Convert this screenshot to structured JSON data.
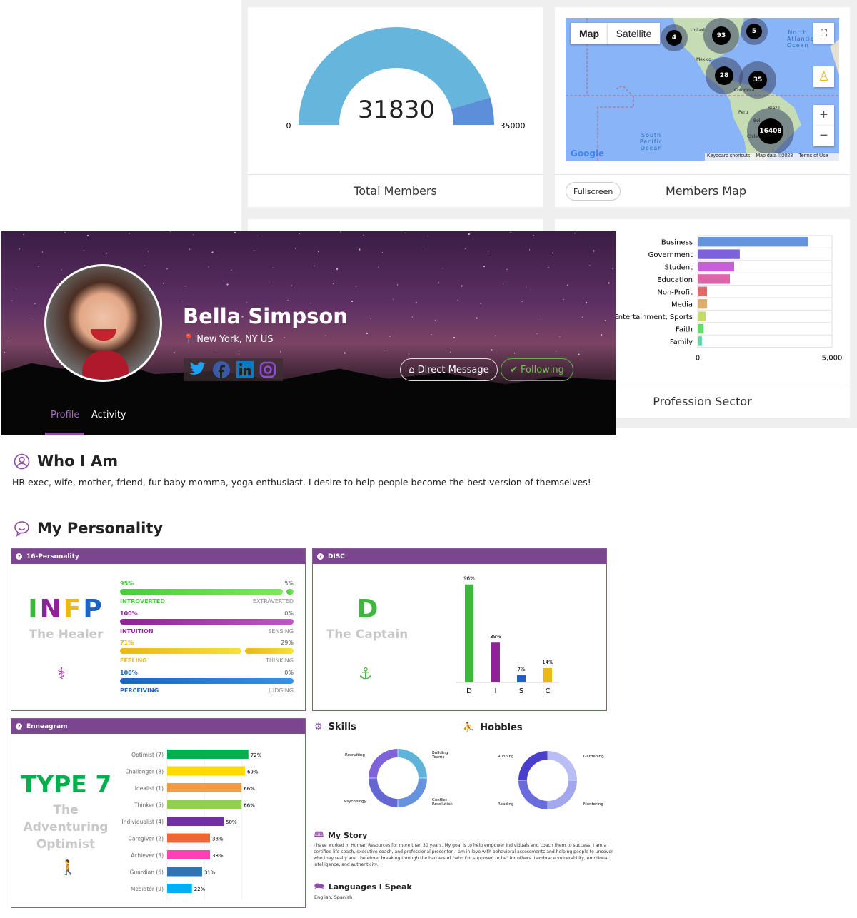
{
  "gauge": {
    "value": 31830,
    "min": 0,
    "max": 35000,
    "min_label": "0",
    "max_label": "35000",
    "title": "Total Members",
    "colors": [
      "#66b5dc",
      "#5c8fd9"
    ]
  },
  "map": {
    "tab_map": "Map",
    "tab_satellite": "Satellite",
    "clusters": [
      "4",
      "93",
      "5",
      "28",
      "35",
      "16408"
    ],
    "labels": {
      "ocean1": "North Atlantic Ocean",
      "ocean2": "South Pacific Ocean",
      "mexico": "Mexico",
      "colombia": "Colombia",
      "peru": "Peru",
      "brazil": "Brazil",
      "chile": "Chile",
      "united": "United",
      "bol": "Bol"
    },
    "attribution": {
      "shortcuts": "Keyboard shortcuts",
      "data": "Map data ©2023",
      "terms": "Terms of Use",
      "logo": "Google"
    },
    "fullscreen_button": "Fullscreen",
    "title": "Members Map"
  },
  "chart_data": [
    {
      "type": "bar",
      "orientation": "horizontal",
      "title": "Profession Sector",
      "categories": [
        "Business",
        "Government",
        "Student",
        "Education",
        "Non-Profit",
        "Media",
        "e, Entertainment, Sports",
        "Faith",
        "Family"
      ],
      "values": [
        4070,
        1540,
        1330,
        1170,
        320,
        320,
        270,
        190,
        130
      ],
      "xlim": [
        0,
        5000
      ],
      "xticks": [
        "0",
        "5,000"
      ],
      "colors": [
        "#6694dc",
        "#7b61db",
        "#c75fd9",
        "#dc64a9",
        "#e06868",
        "#e0ac66",
        "#c5dc64",
        "#66db66",
        "#5fd9a0"
      ],
      "grid": true
    },
    {
      "type": "bar",
      "title": "DISC",
      "categories": [
        "D",
        "I",
        "S",
        "C"
      ],
      "values": [
        96,
        39,
        7,
        14
      ],
      "labels": [
        "96%",
        "39%",
        "7%",
        "14%"
      ],
      "colors": [
        "#3db83a",
        "#8e2296",
        "#1d63c4",
        "#e9b916"
      ]
    },
    {
      "type": "bar",
      "orientation": "horizontal",
      "title": "Enneagram",
      "categories": [
        "Optimist (7)",
        "Challenger (8)",
        "Idealist (1)",
        "Thinker (5)",
        "Individualist (4)",
        "Caregiver (2)",
        "Achiever (3)",
        "Guardian (6)",
        "Mediator (9)"
      ],
      "values": [
        72,
        69,
        66,
        66,
        50,
        38,
        38,
        31,
        22
      ],
      "labels": [
        "72%",
        "69%",
        "66%",
        "66%",
        "50%",
        "38%",
        "38%",
        "31%",
        "22%"
      ],
      "colors": [
        "#00b04f",
        "#ffd900",
        "#f39a45",
        "#92d050",
        "#7030a0",
        "#ec6636",
        "#ff40b4",
        "#2e75b6",
        "#00b0f0"
      ]
    },
    {
      "type": "pie",
      "title": "Skills",
      "categories": [
        "Building Teams",
        "Conflict Resolution",
        "Psychology",
        "Recruiting"
      ],
      "values": [
        25,
        25,
        25,
        25
      ],
      "colors": [
        "#5fb3d9",
        "#6593dd",
        "#6466d4",
        "#7d62d9"
      ]
    },
    {
      "type": "pie",
      "title": "Hobbies",
      "categories": [
        "Gardening",
        "Mentoring",
        "Reading",
        "Running"
      ],
      "values": [
        25,
        25,
        25,
        25
      ],
      "colors": [
        "#b8bdf5",
        "#a3a8ee",
        "#6a6bdc",
        "#4a3fcc"
      ]
    }
  ],
  "profile": {
    "name": "Bella Simpson",
    "location": "New York, NY US",
    "direct_message": "Direct Message",
    "following": "Following",
    "tabs": [
      "Profile",
      "Activity"
    ],
    "socials": [
      "twitter-icon",
      "facebook-icon",
      "linkedin-icon",
      "instagram-icon"
    ]
  },
  "who": {
    "title": "Who I Am",
    "text": "HR exec, wife, mother, friend, fur baby momma, yoga enthusiast. I desire to help people become the best version of themselves!"
  },
  "personality": {
    "title": "My Personality",
    "sixteen": {
      "header": "16-Personality",
      "type": "INFP",
      "subtitle": "The Healer",
      "type_colors": [
        "#3db83a",
        "#8e2296",
        "#e9b916",
        "#1d63c4"
      ],
      "traits": [
        {
          "left_pct": "95%",
          "right_pct": "5%",
          "left": "INTROVERTED",
          "right": "EXTRAVERTED",
          "value": 95,
          "color": "#4cc83f",
          "color2": "#7ee85f"
        },
        {
          "left_pct": "100%",
          "right_pct": "0%",
          "left": "INTUITION",
          "right": "SENSING",
          "value": 100,
          "color": "#8e2296",
          "color2": "#c056c6"
        },
        {
          "left_pct": "71%",
          "right_pct": "29%",
          "left": "FEELING",
          "right": "THINKING",
          "value": 71,
          "color": "#e9b916",
          "color2": "#f8e033"
        },
        {
          "left_pct": "100%",
          "right_pct": "0%",
          "left": "PERCEIVING",
          "right": "JUDGING",
          "value": 100,
          "color": "#1d63c4",
          "color2": "#3a90e8"
        }
      ]
    },
    "disc": {
      "header": "DISC",
      "type": "D",
      "subtitle": "The Captain"
    },
    "enneagram": {
      "header": "Enneagram",
      "type": "TYPE 7",
      "subtitle": "The Adventuring Optimist"
    }
  },
  "skills": {
    "title": "Skills"
  },
  "hobbies": {
    "title": "Hobbies"
  },
  "story": {
    "title": "My Story",
    "text": "I have worked in Human Resources for more than 30 years. My goal is to help empower individuals and coach them to success. I am a certified life coach, executive coach, and professional presenter. I am in love with behavioral assessments and helping people to uncover who they really are; therefore, breaking through the barriers of \"who I'm supposed to be\" for others. I embrace vulnerability, emotional intelligence, and authenticity."
  },
  "languages": {
    "title": "Languages I Speak",
    "text": "English, Spanish"
  }
}
